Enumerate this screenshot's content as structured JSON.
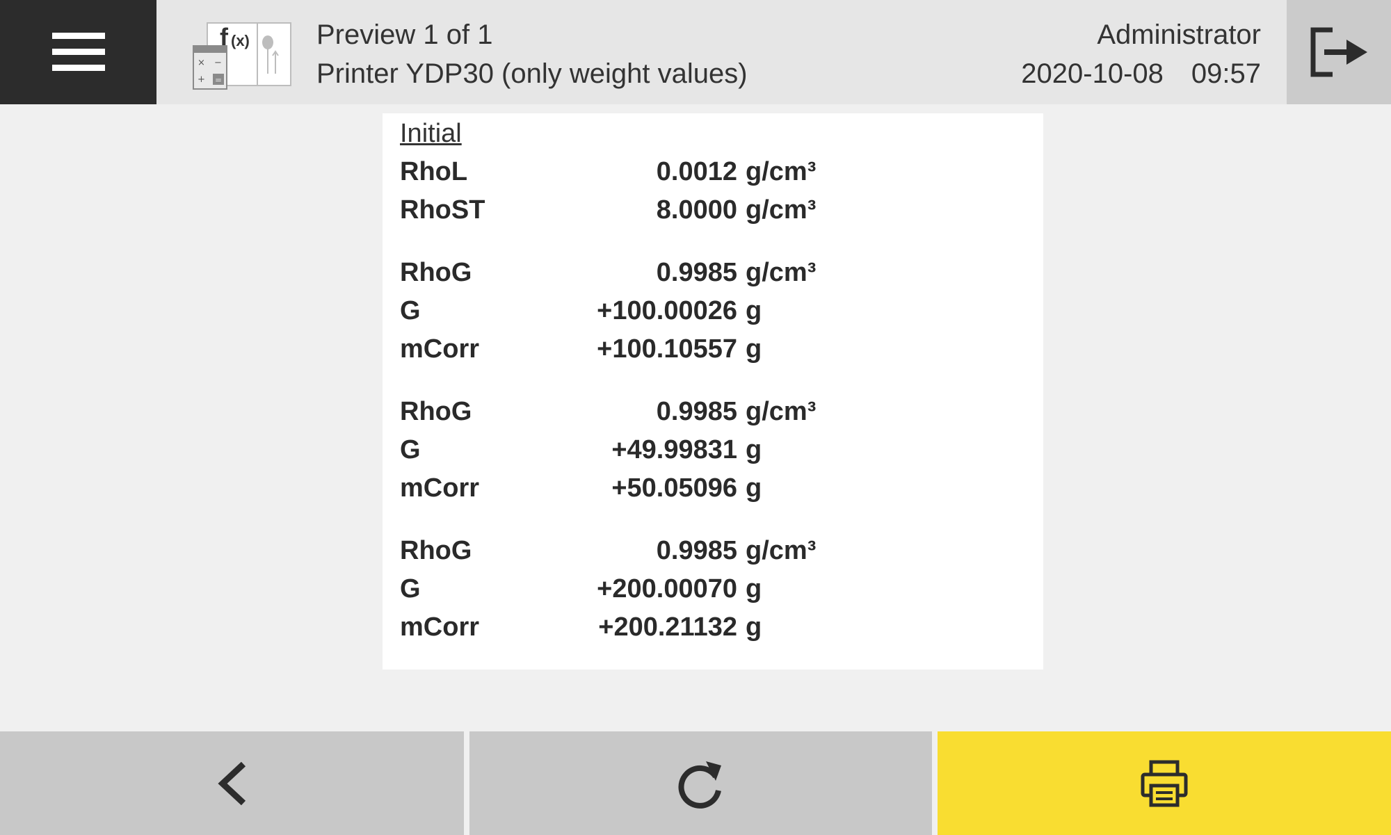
{
  "header": {
    "title": "Preview 1 of 1",
    "subtitle": "Printer YDP30 (only weight values)",
    "user": "Administrator",
    "date": "2020-10-08",
    "time": "09:57",
    "icons": {
      "menu": "hamburger-menu-icon",
      "app": "density-calculator-app-icon",
      "logout": "logout-icon"
    }
  },
  "preview": {
    "heading": "Initial",
    "settings": [
      {
        "label": "RhoL",
        "value": "0.0012",
        "unit": "g/cm³"
      },
      {
        "label": "RhoST",
        "value": "8.0000",
        "unit": "g/cm³"
      }
    ],
    "groups": [
      [
        {
          "label": "RhoG",
          "value": "0.9985",
          "unit": "g/cm³"
        },
        {
          "label": "G",
          "value": "+100.00026",
          "unit": "g"
        },
        {
          "label": "mCorr",
          "value": "+100.10557",
          "unit": "g"
        }
      ],
      [
        {
          "label": "RhoG",
          "value": "0.9985",
          "unit": "g/cm³"
        },
        {
          "label": "G",
          "value": "+49.99831",
          "unit": "g"
        },
        {
          "label": "mCorr",
          "value": "+50.05096",
          "unit": "g"
        }
      ],
      [
        {
          "label": "RhoG",
          "value": "0.9985",
          "unit": "g/cm³"
        },
        {
          "label": "G",
          "value": "+200.00070",
          "unit": "g"
        },
        {
          "label": "mCorr",
          "value": "+200.21132",
          "unit": "g"
        }
      ]
    ]
  },
  "footer": {
    "icons": {
      "back": "chevron-left-icon",
      "refresh": "refresh-icon",
      "print": "printer-icon"
    }
  },
  "colors": {
    "header_bg": "#e6e6e6",
    "menu_bg": "#2c2c2c",
    "logout_bg": "#cbcbcb",
    "footer_button_bg": "#c8c8c8",
    "print_accent": "#f9dd31",
    "page_bg": "#f0f0f0",
    "paper_bg": "#ffffff"
  }
}
